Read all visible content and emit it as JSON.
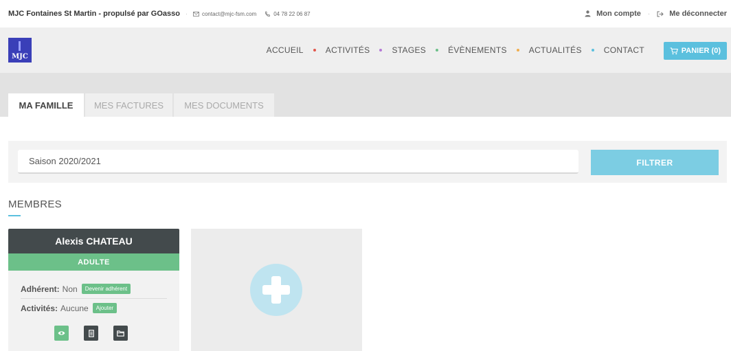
{
  "topbar": {
    "site_name": "MJC Fontaines St Martin - propulsé par GOasso",
    "email": "contact@mjc-fsm.com",
    "phone": "04 78 22 06 87",
    "account": "Mon compte",
    "logout": "Me déconnecter"
  },
  "logo": {
    "text": "MJC"
  },
  "nav": {
    "items": [
      {
        "label": "ACCUEIL",
        "dot_color": "#e2574c"
      },
      {
        "label": "ACTIVITÉS",
        "dot_color": "#b57ad6"
      },
      {
        "label": "STAGES",
        "dot_color": "#6cc089"
      },
      {
        "label": "ÉVÈNEMENTS",
        "dot_color": "#f0ad4e"
      },
      {
        "label": "ACTUALITÉS",
        "dot_color": "#5bc0de"
      },
      {
        "label": "CONTACT",
        "dot_color": ""
      }
    ],
    "cart_label": "PANIER (0)"
  },
  "tabs": [
    {
      "label": "MA FAMILLE",
      "active": true
    },
    {
      "label": "MES FACTURES",
      "active": false
    },
    {
      "label": "MES DOCUMENTS",
      "active": false
    }
  ],
  "filter": {
    "season_value": "Saison 2020/2021",
    "button_label": "FILTRER"
  },
  "members": {
    "title": "MEMBRES",
    "cards": [
      {
        "name": "Alexis CHATEAU",
        "type": "ADULTE",
        "adherent_label": "Adhérent:",
        "adherent_value": "Non",
        "adherent_action": "Devenir adhérent",
        "activities_label": "Activités:",
        "activities_value": "Aucune",
        "activities_action": "Ajouter"
      }
    ]
  },
  "colors": {
    "accent": "#5bc0de",
    "green": "#6cc089",
    "dark": "#434a4c"
  }
}
